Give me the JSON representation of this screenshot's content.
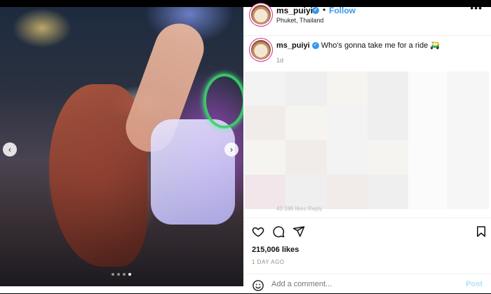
{
  "header": {
    "username": "ms_puiyi",
    "separator": "•",
    "follow_label": "Follow",
    "location": "Phuket, Thailand",
    "more_label": "•••"
  },
  "caption": {
    "username": "ms_puiyi",
    "text": "Who's gonna take me for a ride",
    "emoji": "🛺",
    "age": "1d"
  },
  "faded_row": "43   186 likes   Reply",
  "engagement": {
    "likes": "215,006 likes",
    "date": "1 DAY AGO"
  },
  "comment": {
    "placeholder": "Add a comment...",
    "post_label": "Post"
  },
  "carousel": {
    "prev": "‹",
    "next": "›",
    "slide_count": 4,
    "active_index": 3
  },
  "colors": {
    "accent": "#3797f0",
    "post_disabled": "#b2dffc",
    "muted": "#8e8e8e"
  },
  "icons": [
    "heart-icon",
    "comment-icon",
    "share-icon",
    "bookmark-icon",
    "emoji-icon",
    "verified-icon"
  ]
}
